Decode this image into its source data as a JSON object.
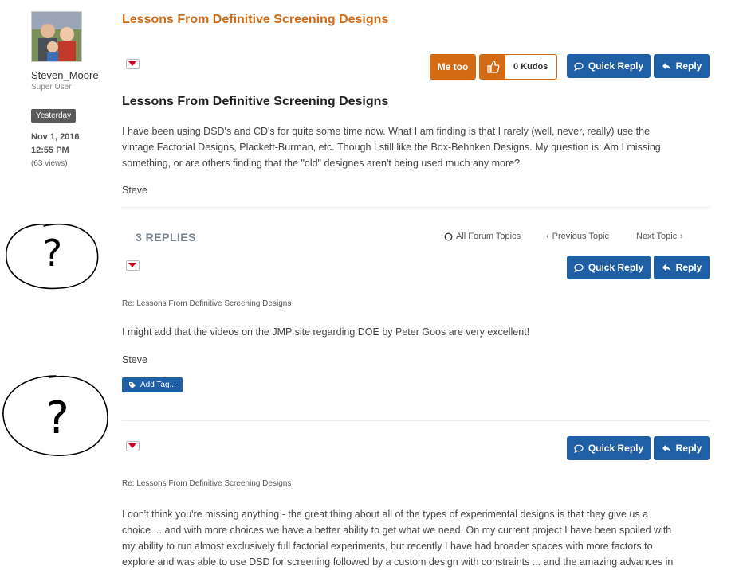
{
  "author": {
    "username": "Steven_Moore",
    "rank": "Super User",
    "badge": "Yesterday",
    "date": "Nov 1, 2016",
    "time": "12:55 PM",
    "views": "(63 views)"
  },
  "topic": {
    "title": "Lessons From Definitive Screening Designs",
    "subject": "Lessons From Definitive Screening Designs",
    "body_lines": [
      "I have been using DSD's and CD's for quite some time now.  What I am finding is that I rarely (well, never, really) use the",
      "vintage Factorial Designs, Plackett-Burman, etc.  Though I still like the Box-Behnken Designs.  My question is:  Am I missing",
      "something, or are others finding that the \"old\" designes aren't being used much any more?"
    ],
    "signature": "Steve"
  },
  "actions": {
    "me_too": "Me too",
    "kudos": "0 Kudos",
    "quick_reply": "Quick Reply",
    "reply": "Reply"
  },
  "replies_bar": {
    "count_label": "3 REPLIES",
    "all_topics": "All Forum Topics",
    "previous": "Previous Topic",
    "next": "Next Topic"
  },
  "reply1": {
    "re": "Re: Lessons From Definitive Screening Designs",
    "body": "I might add that the videos on the JMP site regarding DOE by Peter Goos are very excellent!",
    "signature": "Steve",
    "add_tag": "Add Tag..."
  },
  "reply2": {
    "re": "Re: Lessons From Definitive Screening Designs",
    "body_lines": [
      "I don't think you're missing anything - the great thing about all of the types of experimental designs is that they give us a",
      "choice ... and with more choices we have a better ability to get what we need. On my current project I have been spoiled with",
      "my ability to run almost exclusively full factorial experiments, but recently I have had broader spaces with more factors to",
      "explore and was able to use DSD for screening followed by a custom design with constraints ... and the amazing advances in"
    ]
  },
  "annotations": {
    "mark1": "?",
    "mark2": "?"
  },
  "colors": {
    "accent_orange": "#d36b14",
    "button_blue": "#1f5fa6",
    "caret_red": "#d0021b"
  }
}
